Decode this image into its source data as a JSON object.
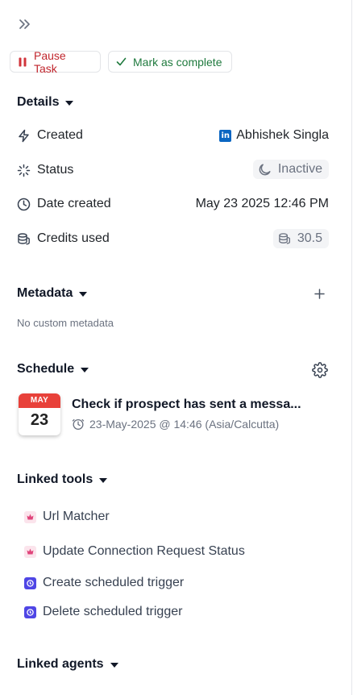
{
  "header": {
    "expand_icon": "chevrons-right-icon"
  },
  "actions": {
    "pause_label": "Pause Task",
    "complete_label": "Mark as complete"
  },
  "details": {
    "title": "Details",
    "created_label": "Created",
    "created_value": "Abhishek Singla",
    "created_icon": "linkedin-icon",
    "status_label": "Status",
    "status_value": "Inactive",
    "date_label": "Date created",
    "date_value": "May 23 2025 12:46 PM",
    "credits_label": "Credits used",
    "credits_value": "30.5"
  },
  "metadata": {
    "title": "Metadata",
    "empty_text": "No custom metadata"
  },
  "schedule": {
    "title": "Schedule",
    "calendar_month": "MAY",
    "calendar_day": "23",
    "item_title": "Check if prospect has sent a messa...",
    "item_time": "23-May-2025 @ 14:46 (Asia/Calcutta)"
  },
  "linked_tools": {
    "title": "Linked tools",
    "items": [
      {
        "label": "Url Matcher",
        "icon": "lotus-icon"
      },
      {
        "label": "Update Connection Request Status",
        "icon": "lotus-icon"
      },
      {
        "label": "Create scheduled trigger",
        "icon": "clock-badge-icon"
      },
      {
        "label": "Delete scheduled trigger",
        "icon": "clock-badge-icon"
      }
    ]
  },
  "linked_agents": {
    "title": "Linked agents"
  },
  "colors": {
    "pause_red": "#c0262d",
    "complete_green": "#1f7a3e",
    "linkedin_blue": "#0a66c2",
    "calendar_red": "#e8413a",
    "tool_indigo": "#4f46e5"
  }
}
